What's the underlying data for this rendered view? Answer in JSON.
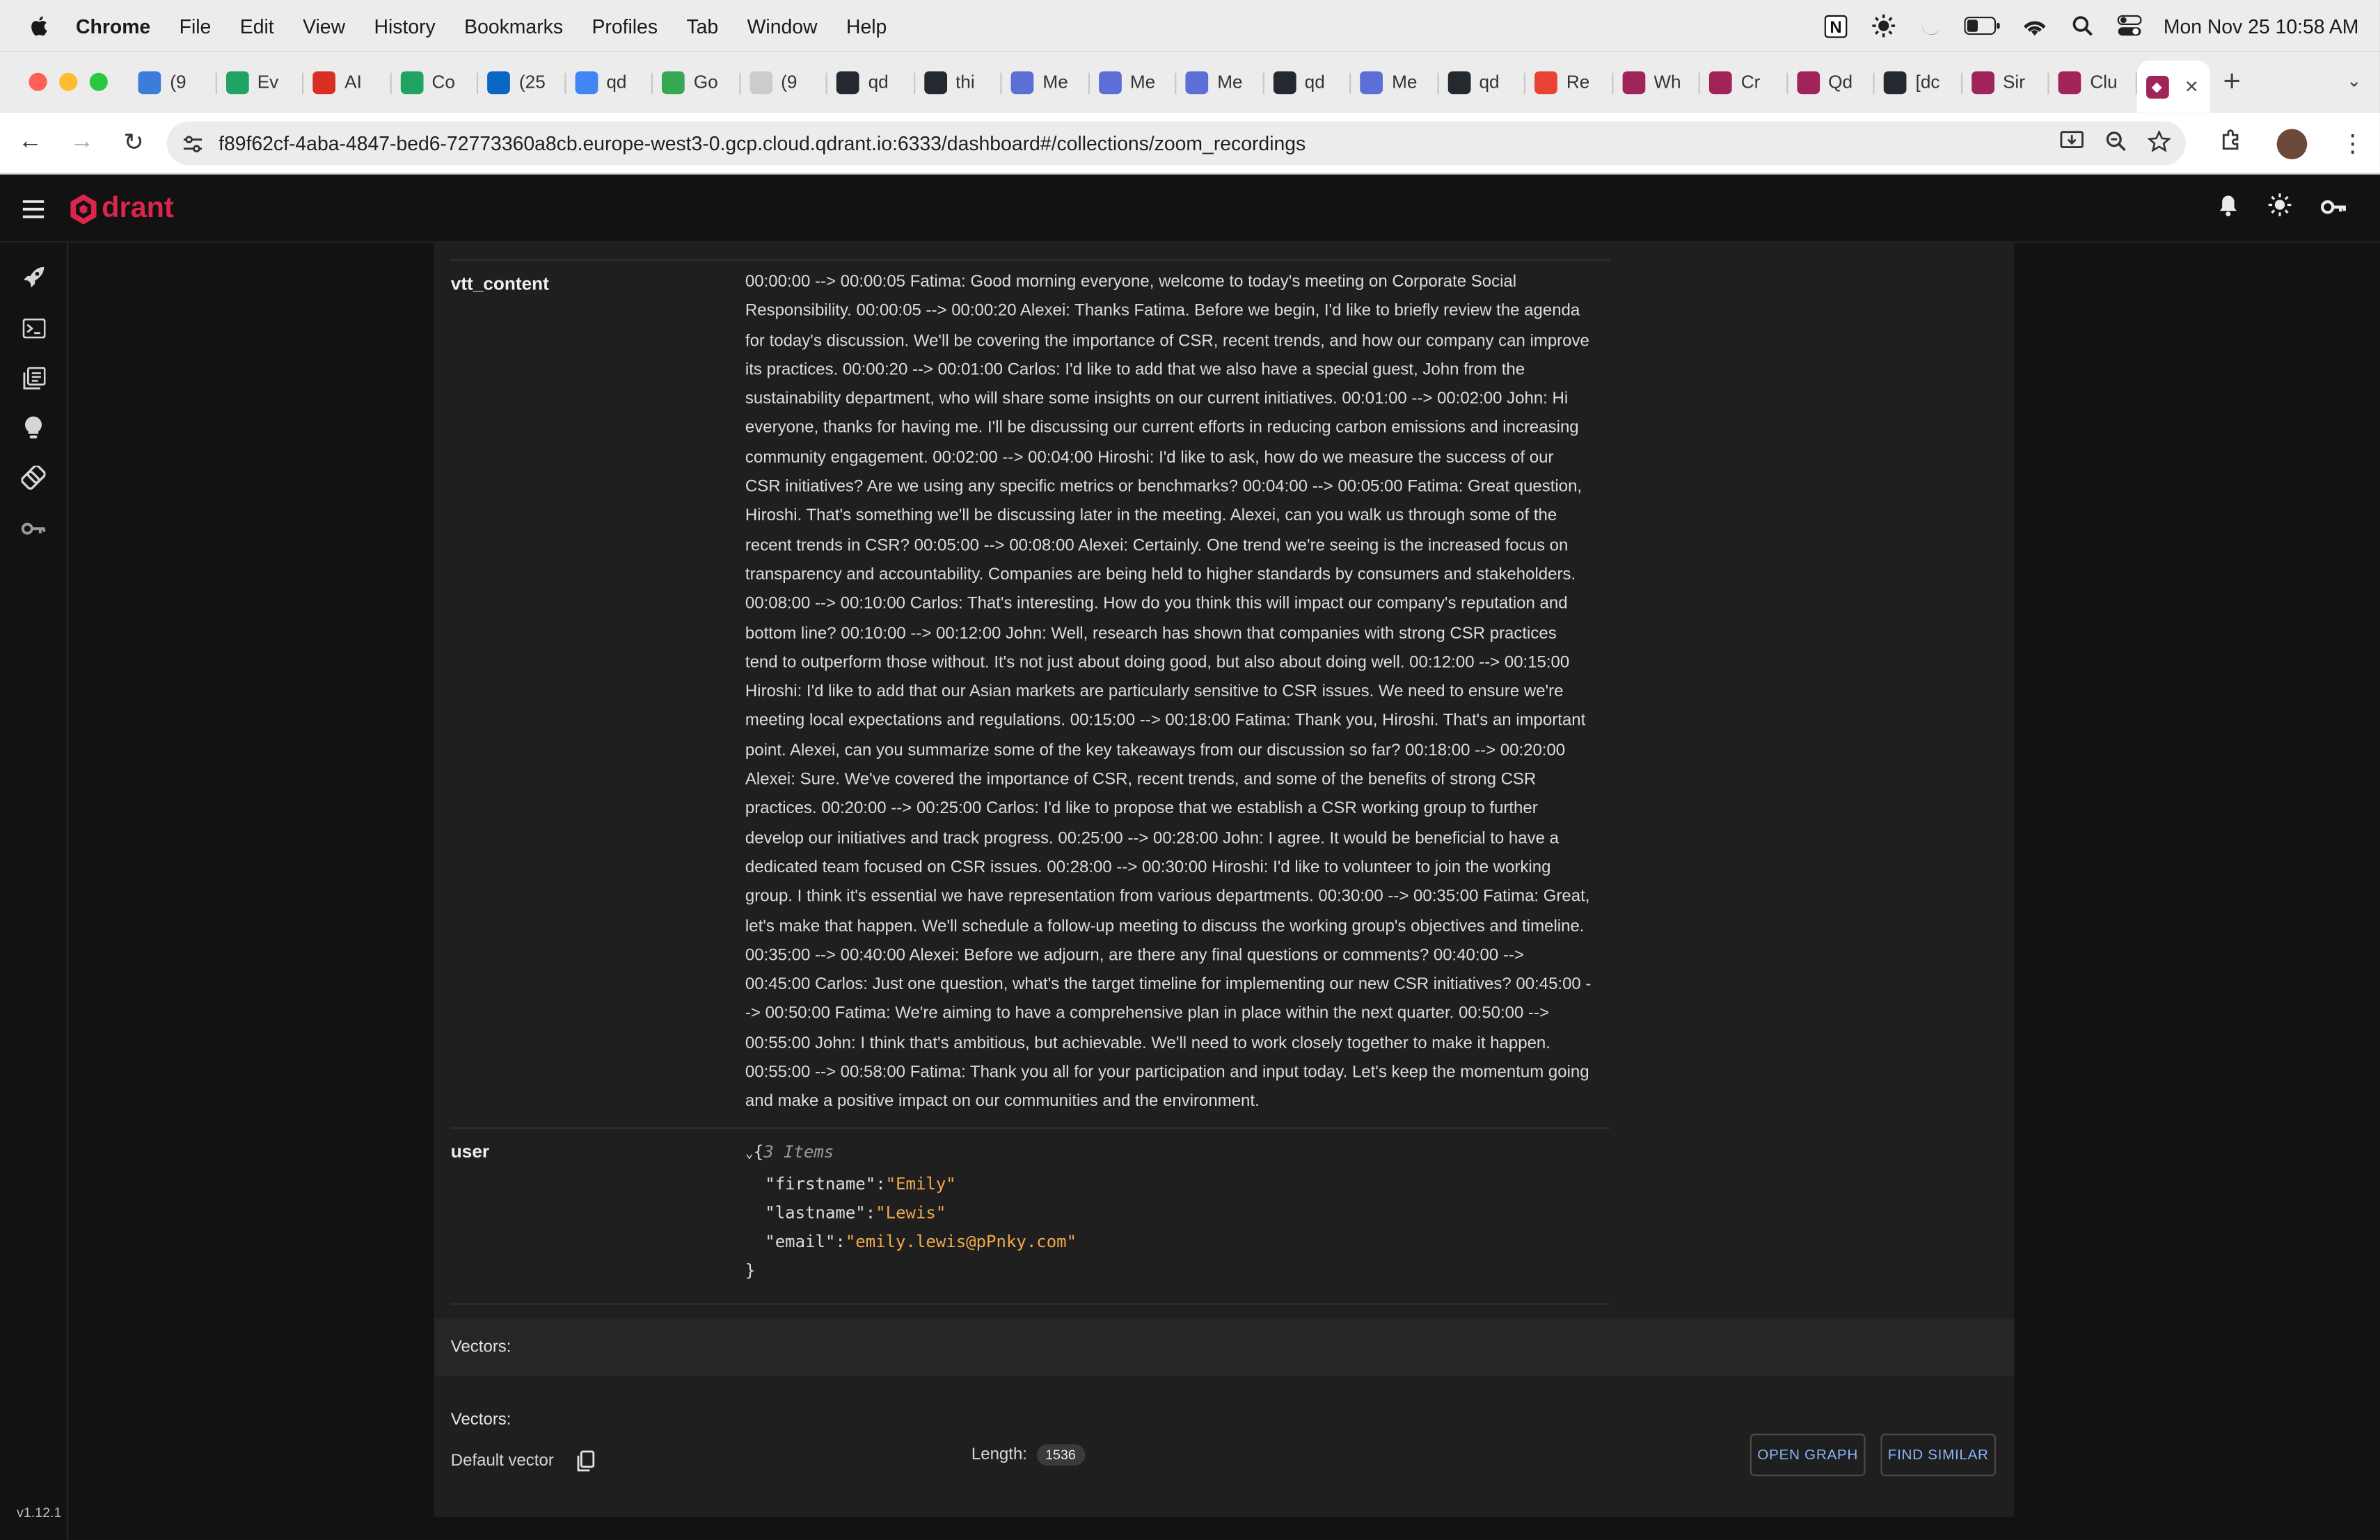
{
  "menubar": {
    "app": "Chrome",
    "items": [
      "File",
      "Edit",
      "View",
      "History",
      "Bookmarks",
      "Profiles",
      "Tab",
      "Window",
      "Help"
    ],
    "datetime": "Mon Nov 25  10:58 AM"
  },
  "tabs": [
    {
      "label": "(9",
      "color": "#3b7dd8"
    },
    {
      "label": "Ev",
      "color": "#1fa463"
    },
    {
      "label": "AI",
      "color": "#d93025"
    },
    {
      "label": "Co",
      "color": "#1fa463"
    },
    {
      "label": "(25",
      "color": "#0a66c2"
    },
    {
      "label": "qd",
      "color": "#4285f4"
    },
    {
      "label": "Go",
      "color": "#34a853"
    },
    {
      "label": "(9",
      "color": "#cccccc"
    },
    {
      "label": "qd",
      "color": "#24292f"
    },
    {
      "label": "thi",
      "color": "#24292f"
    },
    {
      "label": "Me",
      "color": "#5b6fd6"
    },
    {
      "label": "Me",
      "color": "#5b6fd6"
    },
    {
      "label": "Me",
      "color": "#5b6fd6"
    },
    {
      "label": "qd",
      "color": "#24292f"
    },
    {
      "label": "Me",
      "color": "#5b6fd6"
    },
    {
      "label": "qd",
      "color": "#24292f"
    },
    {
      "label": "Re",
      "color": "#ea4335"
    },
    {
      "label": "Wh",
      "color": "#a0245a"
    },
    {
      "label": "Cr",
      "color": "#a0245a"
    },
    {
      "label": "Qd",
      "color": "#a0245a"
    },
    {
      "label": "[dc",
      "color": "#24292f"
    },
    {
      "label": "Sir",
      "color": "#a0245a"
    },
    {
      "label": "Clu",
      "color": "#a0245a"
    }
  ],
  "address": {
    "url": "f89f62cf-4aba-4847-bed6-72773360a8cb.europe-west3-0.gcp.cloud.qdrant.io:6333/dashboard#/collections/zoom_recordings"
  },
  "app": {
    "logo_text": "drant",
    "version": "v1.12.1"
  },
  "payload": {
    "vtt_key": "vtt_content",
    "vtt_lines": [
      "00:00:00 --> 00:00:05 Fatima: Good morning everyone, welcome to today's meeting on Corporate Social",
      "Responsibility. 00:00:05 --> 00:00:20 Alexei: Thanks Fatima. Before we begin, I'd like to briefly review the agenda",
      "for today's discussion. We'll be covering the importance of CSR, recent trends, and how our company can improve",
      "its practices. 00:00:20 --> 00:01:00 Carlos: I'd like to add that we also have a special guest, John from the",
      "sustainability department, who will share some insights on our current initiatives. 00:01:00 --> 00:02:00 John: Hi",
      "everyone, thanks for having me. I'll be discussing our current efforts in reducing carbon emissions and increasing",
      "community engagement. 00:02:00 --> 00:04:00 Hiroshi: I'd like to ask, how do we measure the success of our",
      "CSR initiatives? Are we using any specific metrics or benchmarks? 00:04:00 --> 00:05:00 Fatima: Great question,",
      "Hiroshi. That's something we'll be discussing later in the meeting. Alexei, can you walk us through some of the",
      "recent trends in CSR? 00:05:00 --> 00:08:00 Alexei: Certainly. One trend we're seeing is the increased focus on",
      "transparency and accountability. Companies are being held to higher standards by consumers and stakeholders.",
      "00:08:00 --> 00:10:00 Carlos: That's interesting. How do you think this will impact our company's reputation and",
      "bottom line? 00:10:00 --> 00:12:00 John: Well, research has shown that companies with strong CSR practices",
      "tend to outperform those without. It's not just about doing good, but also about doing well. 00:12:00 --> 00:15:00",
      "Hiroshi: I'd like to add that our Asian markets are particularly sensitive to CSR issues. We need to ensure we're",
      "meeting local expectations and regulations. 00:15:00 --> 00:18:00 Fatima: Thank you, Hiroshi. That's an important",
      "point. Alexei, can you summarize some of the key takeaways from our discussion so far? 00:18:00 --> 00:20:00",
      "Alexei: Sure. We've covered the importance of CSR, recent trends, and some of the benefits of strong CSR",
      "practices. 00:20:00 --> 00:25:00 Carlos: I'd like to propose that we establish a CSR working group to further",
      "develop our initiatives and track progress. 00:25:00 --> 00:28:00 John: I agree. It would be beneficial to have a",
      "dedicated team focused on CSR issues. 00:28:00 --> 00:30:00 Hiroshi: I'd like to volunteer to join the working",
      "group. I think it's essential we have representation from various departments. 00:30:00 --> 00:35:00 Fatima: Great,",
      "let's make that happen. We'll schedule a follow-up meeting to discuss the working group's objectives and timeline.",
      "00:35:00 --> 00:40:00 Alexei: Before we adjourn, are there any final questions or comments? 00:40:00 -->",
      "00:45:00 Carlos: Just one question, what's the target timeline for implementing our new CSR initiatives? 00:45:00 -",
      "-> 00:50:00 Fatima: We're aiming to have a comprehensive plan in place within the next quarter. 00:50:00 -->",
      "00:55:00 John: I think that's ambitious, but achievable. We'll need to work closely together to make it happen.",
      "00:55:00 --> 00:58:00 Fatima: Thank you all for your participation and input today. Let's keep the momentum going",
      "and make a positive impact on our communities and the environment."
    ],
    "user_key": "user",
    "user_count": "3 Items",
    "user_fields": [
      {
        "k": "\"firstname\"",
        "v": "\"Emily\""
      },
      {
        "k": "\"lastname\"",
        "v": "\"Lewis\""
      },
      {
        "k": "\"email\"",
        "v": "\"emily.lewis@pPnky.com\""
      }
    ]
  },
  "vectors": {
    "bar_label": "Vectors:",
    "label": "Vectors:",
    "default_vector": "Default vector",
    "length_label": "Length:",
    "length_value": "1536",
    "open_graph": "OPEN GRAPH",
    "find_similar": "FIND SIMILAR"
  },
  "colors": {
    "brand": "#dc244c",
    "link_button": "#8ab4f8",
    "json_string": "#f0a94b"
  }
}
